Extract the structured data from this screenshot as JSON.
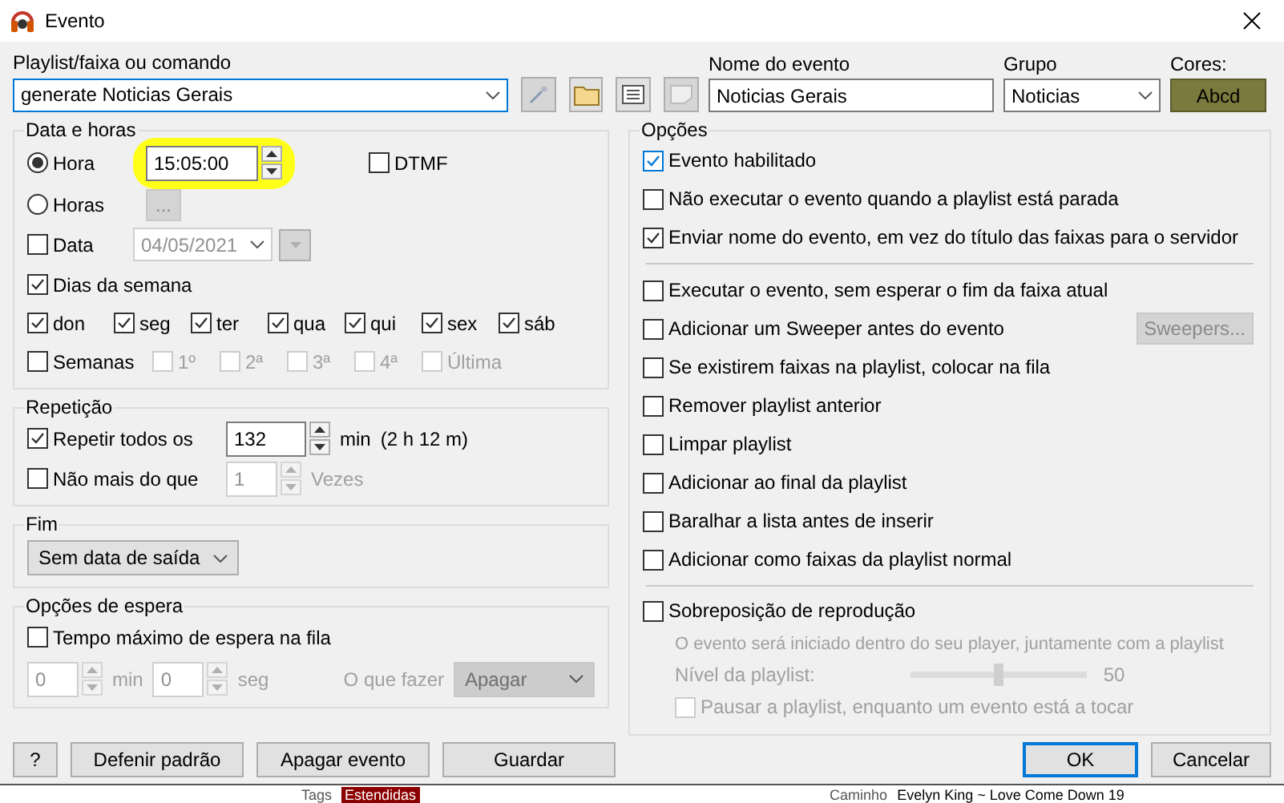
{
  "window": {
    "title": "Evento"
  },
  "command": {
    "label": "Playlist/faixa ou comando",
    "value": "generate Noticias Gerais"
  },
  "event_name": {
    "label": "Nome do evento",
    "value": "Noticias Gerais"
  },
  "group": {
    "label": "Grupo",
    "value": "Noticias"
  },
  "colors": {
    "label": "Cores:",
    "sample": "Abcd"
  },
  "date_time": {
    "title": "Data e horas",
    "modes": [
      {
        "label": "Hora",
        "selected": true,
        "kind": "time",
        "value": "15:05:00",
        "highlighted": true
      },
      {
        "label": "Horas",
        "selected": false,
        "kind": "button",
        "button": "..."
      }
    ],
    "dtmf": {
      "label": "DTMF",
      "checked": false
    },
    "date": {
      "label": "Data",
      "checked": false,
      "value": "04/05/2021"
    },
    "weekdays": {
      "label": "Dias da semana",
      "checked": true
    },
    "days": [
      {
        "label": "don",
        "checked": true
      },
      {
        "label": "seg",
        "checked": true
      },
      {
        "label": "ter",
        "checked": true
      },
      {
        "label": "qua",
        "checked": true
      },
      {
        "label": "qui",
        "checked": true
      },
      {
        "label": "sex",
        "checked": true
      },
      {
        "label": "sáb",
        "checked": true
      }
    ],
    "weeks": {
      "label": "Semanas",
      "checked": false,
      "items": [
        {
          "label": "1º",
          "checked": false
        },
        {
          "label": "2ª",
          "checked": false
        },
        {
          "label": "3ª",
          "checked": false
        },
        {
          "label": "4ª",
          "checked": false
        },
        {
          "label": "Última",
          "checked": false
        }
      ]
    }
  },
  "repetition": {
    "title": "Repetição",
    "repeat": {
      "label": "Repetir todos os",
      "checked": true,
      "value": "132",
      "unit": "min",
      "note": "(2 h 12 m)"
    },
    "limit": {
      "label": "Não mais do que",
      "checked": false,
      "value": "1",
      "unit": "Vezes"
    }
  },
  "end": {
    "title": "Fim",
    "value": "Sem data de saída"
  },
  "wait": {
    "title": "Opções de espera",
    "max_wait": {
      "label": "Tempo máximo de espera na fila",
      "checked": false
    },
    "minutes": {
      "value": "0",
      "unit": "min"
    },
    "seconds": {
      "value": "0",
      "unit": "seg"
    },
    "action": {
      "label": "O que fazer",
      "value": "Apagar"
    }
  },
  "options": {
    "title": "Opções",
    "sections": [
      [
        {
          "label": "Evento habilitado",
          "checked": true,
          "focused": true
        },
        {
          "label": "Não executar o evento quando a playlist está parada",
          "checked": false
        },
        {
          "label": "Enviar nome do evento, em vez do título das faixas para o servidor",
          "checked": true
        }
      ],
      [
        {
          "label": "Executar o evento, sem esperar o fim da faixa atual",
          "checked": false
        },
        {
          "label": "Adicionar um Sweeper antes do evento",
          "checked": false,
          "button": "Sweepers..."
        },
        {
          "label": "Se existirem faixas na playlist, colocar na fila",
          "checked": false
        },
        {
          "label": "Remover playlist anterior",
          "checked": false
        },
        {
          "label": "Limpar playlist",
          "checked": false
        },
        {
          "label": "Adicionar ao final da playlist",
          "checked": false
        },
        {
          "label": "Baralhar a lista antes de inserir",
          "checked": false
        },
        {
          "label": "Adicionar como faixas da playlist normal",
          "checked": false
        }
      ]
    ],
    "overlap": {
      "label": "Sobreposição de reprodução",
      "checked": false,
      "note": "O evento será iniciado dentro do seu player, juntamente com a playlist",
      "level_label": "Nível da playlist:",
      "level": 0.5,
      "reading": "50",
      "pause": {
        "label": "Pausar a playlist, enquanto um evento está a tocar",
        "checked": false
      }
    }
  },
  "buttons_left": [
    {
      "label": "?",
      "default": false
    },
    {
      "label": "Defenir padrão",
      "default": false
    },
    {
      "label": "Apagar evento",
      "default": false
    },
    {
      "label": "Guardar",
      "default": false
    }
  ],
  "buttons_right": [
    {
      "label": "OK",
      "default": true
    },
    {
      "label": "Cancelar",
      "default": false
    }
  ],
  "background_window": {
    "tags_label": "Tags",
    "tag": "Estendidas",
    "path_label": "Caminho",
    "path": "Evelyn King ~ Love Come Down 19"
  }
}
